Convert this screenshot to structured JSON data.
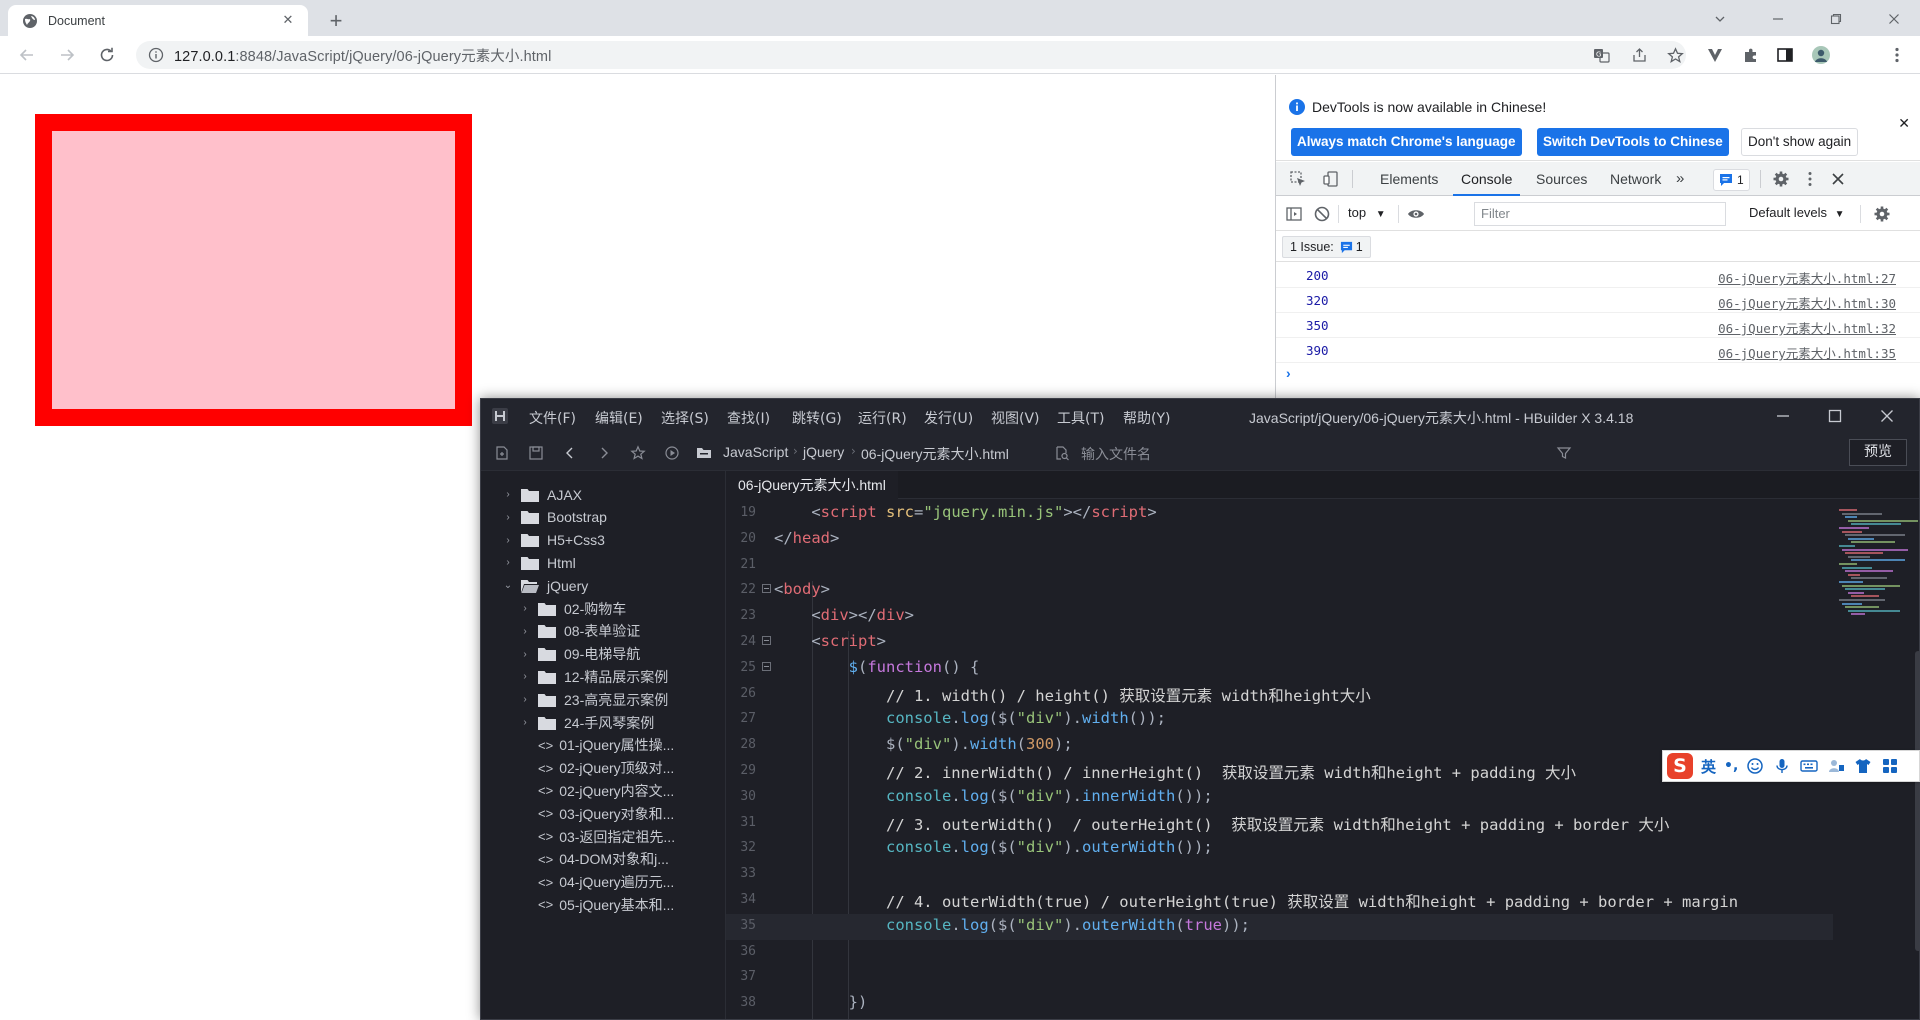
{
  "browser": {
    "tab_title": "Document",
    "url_host": "127.0.0.1",
    "url_rest": ":8848/JavaScript/jQuery/06-jQuery元素大小.html"
  },
  "page": {
    "box_fill": "#ffc0cb",
    "box_border": "#ff0000"
  },
  "devtools": {
    "banner_message": "DevTools is now available in Chinese!",
    "banner_btn_match": "Always match Chrome's language",
    "banner_btn_switch": "Switch DevTools to Chinese",
    "banner_btn_dismiss": "Don't show again",
    "tabs": [
      "Elements",
      "Console",
      "Sources",
      "Network"
    ],
    "active_tab": "Console",
    "message_count": "1",
    "context": "top",
    "filter_placeholder": "Filter",
    "levels": "Default levels",
    "issues_label": "1 Issue:",
    "issues_count": "1",
    "logs": [
      {
        "value": "200",
        "source": "06-jQuery元素大小.html:27"
      },
      {
        "value": "320",
        "source": "06-jQuery元素大小.html:30"
      },
      {
        "value": "350",
        "source": "06-jQuery元素大小.html:32"
      },
      {
        "value": "390",
        "source": "06-jQuery元素大小.html:35"
      }
    ],
    "prompt": "›"
  },
  "hbuilder": {
    "menus": [
      "文件(F)",
      "编辑(E)",
      "选择(S)",
      "查找(I)",
      "跳转(G)",
      "运行(R)",
      "发行(U)",
      "视图(V)",
      "工具(T)",
      "帮助(Y)"
    ],
    "window_title": "JavaScript/jQuery/06-jQuery元素大小.html - HBuilder X 3.4.18",
    "breadcrumb": [
      "JavaScript",
      "jQuery",
      "06-jQuery元素大小.html"
    ],
    "file_search_placeholder": "输入文件名",
    "preview_label": "预览",
    "file_tab": "06-jQuery元素大小.html",
    "tree": [
      {
        "label": "AJAX",
        "type": "folder",
        "level": 0,
        "expanded": false
      },
      {
        "label": "Bootstrap",
        "type": "folder",
        "level": 0,
        "expanded": false
      },
      {
        "label": "H5+Css3",
        "type": "folder",
        "level": 0,
        "expanded": false
      },
      {
        "label": "Html",
        "type": "folder",
        "level": 0,
        "expanded": false
      },
      {
        "label": "jQuery",
        "type": "folder",
        "level": 0,
        "expanded": true
      },
      {
        "label": "02-购物车",
        "type": "folder",
        "level": 1,
        "expanded": false
      },
      {
        "label": "08-表单验证",
        "type": "folder",
        "level": 1,
        "expanded": false
      },
      {
        "label": "09-电梯导航",
        "type": "folder",
        "level": 1,
        "expanded": false
      },
      {
        "label": "12-精品展示案例",
        "type": "folder",
        "level": 1,
        "expanded": false
      },
      {
        "label": "23-高亮显示案例",
        "type": "folder",
        "level": 1,
        "expanded": false
      },
      {
        "label": "24-手风琴案例",
        "type": "folder",
        "level": 1,
        "expanded": false
      },
      {
        "label": "01-jQuery属性操...",
        "type": "file",
        "level": 1
      },
      {
        "label": "02-jQuery顶级对...",
        "type": "file",
        "level": 1
      },
      {
        "label": "02-jQuery内容文...",
        "type": "file",
        "level": 1
      },
      {
        "label": "03-jQuery对象和...",
        "type": "file",
        "level": 1
      },
      {
        "label": "03-返回指定祖先...",
        "type": "file",
        "level": 1
      },
      {
        "label": "04-DOM对象和j...",
        "type": "file",
        "level": 1
      },
      {
        "label": "04-jQuery遍历元...",
        "type": "file",
        "level": 1
      },
      {
        "label": "05-jQuery基本和...",
        "type": "file",
        "level": 1
      }
    ],
    "file_tag": "<>",
    "code_lines": [
      {
        "n": "19",
        "fold": false
      },
      {
        "n": "20",
        "fold": false
      },
      {
        "n": "21",
        "fold": false
      },
      {
        "n": "22",
        "fold": true
      },
      {
        "n": "23",
        "fold": false
      },
      {
        "n": "24",
        "fold": true
      },
      {
        "n": "25",
        "fold": true
      },
      {
        "n": "26",
        "fold": false
      },
      {
        "n": "27",
        "fold": false
      },
      {
        "n": "28",
        "fold": false
      },
      {
        "n": "29",
        "fold": false
      },
      {
        "n": "30",
        "fold": false
      },
      {
        "n": "31",
        "fold": false
      },
      {
        "n": "32",
        "fold": false
      },
      {
        "n": "33",
        "fold": false
      },
      {
        "n": "34",
        "fold": false
      },
      {
        "n": "35",
        "fold": false
      },
      {
        "n": "36",
        "fold": false
      },
      {
        "n": "37",
        "fold": false
      },
      {
        "n": "38",
        "fold": false
      }
    ],
    "code": {
      "l19_tag": "script",
      "l19_attr": "src",
      "l19_val": "\"jquery.min.js\"",
      "l19_close": "script",
      "l20_tag": "head",
      "l22_tag": "body",
      "l23_tag": "div",
      "l23_close": "div",
      "l24_tag": "script",
      "l25_fn": "$",
      "l25_kw": "function",
      "l26_comment": "// 1. width() / height() 获取设置元素 width和height大小",
      "l27_obj": "console",
      "l27_m": "log",
      "l27_sel": "\"div\"",
      "l27_call": "width",
      "l28_sel": "\"div\"",
      "l28_call": "width",
      "l28_num": "300",
      "l29_comment": "// 2. innerWidth() / innerHeight()  获取设置元素 width和height + padding 大小",
      "l30_obj": "console",
      "l30_m": "log",
      "l30_sel": "\"div\"",
      "l30_call": "innerWidth",
      "l31_comment": "// 3. outerWidth()  / outerHeight()  获取设置元素 width和height + padding + border 大小",
      "l32_obj": "console",
      "l32_m": "log",
      "l32_sel": "\"div\"",
      "l32_call": "outerWidth",
      "l34_comment": "// 4. outerWidth(true) / outerHeight(true) 获取设置 width和height + padding + border + margin",
      "l35_obj": "console",
      "l35_m": "log",
      "l35_sel": "\"div\"",
      "l35_call": "outerWidth",
      "l35_kw": "true",
      "l38_close": "})"
    }
  },
  "ime": {
    "logo": "S",
    "mode": "英",
    "punct": "•,"
  }
}
